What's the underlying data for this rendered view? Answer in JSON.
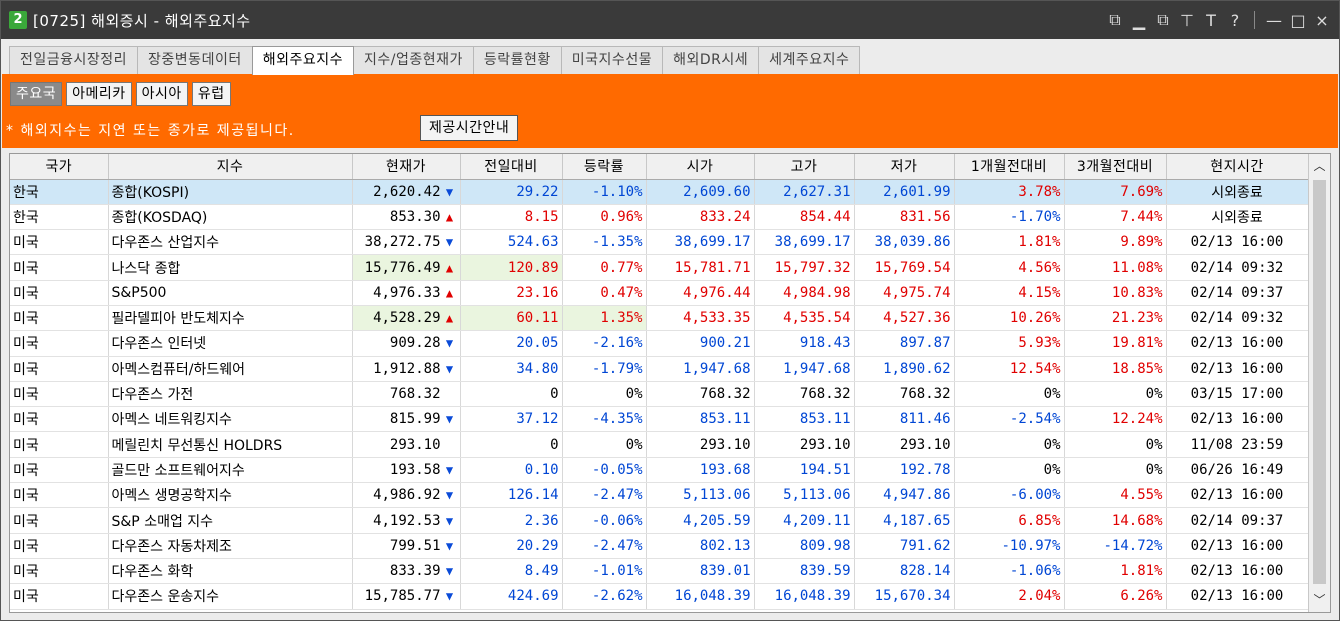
{
  "window": {
    "badge": "2",
    "title": "[0725] 해외증시 - 해외주요지수",
    "controls": [
      "⧉",
      "▁",
      "⧉",
      "⊤",
      "T",
      "?",
      "—",
      "□",
      "×"
    ]
  },
  "tabs": [
    "전일금융시장정리",
    "장중변동데이터",
    "해외주요지수",
    "지수/업종현재가",
    "등락률현황",
    "미국지수선물",
    "해외DR시세",
    "세계주요지수"
  ],
  "active_tab": 2,
  "subtabs": [
    "주요국",
    "아메리카",
    "아시아",
    "유럽"
  ],
  "active_subtab": 0,
  "notice": "* 해외지수는 지연 또는 종가로 제공됩니다.",
  "info_button": "제공시간안내",
  "columns": [
    "국가",
    "지수",
    "현재가",
    "전일대비",
    "등락률",
    "시가",
    "고가",
    "저가",
    "1개월전대비",
    "3개월전대비",
    "현지시간"
  ],
  "colors": {
    "up": "#e00000",
    "down": "#0046d4",
    "accent": "#ff6a00",
    "selected_row": "#cfe7f7"
  },
  "rows": [
    {
      "country": "한국",
      "name": "종합(KOSPI)",
      "price": "2,620.42",
      "dir": "down",
      "chg": "29.22",
      "rate": "-1.10%",
      "open": "2,609.60",
      "high": "2,627.31",
      "low": "2,601.99",
      "m1": "3.78%",
      "m3": "7.69%",
      "time": "시외종료"
    },
    {
      "country": "한국",
      "name": "종합(KOSDAQ)",
      "price": "853.30",
      "dir": "up",
      "chg": "8.15",
      "rate": "0.96%",
      "open": "833.24",
      "high": "854.44",
      "low": "831.56",
      "m1": "-1.70%",
      "m3": "7.44%",
      "time": "시외종료"
    },
    {
      "country": "미국",
      "name": "다우존스 산업지수",
      "price": "38,272.75",
      "dir": "down",
      "chg": "524.63",
      "rate": "-1.35%",
      "open": "38,699.17",
      "high": "38,699.17",
      "low": "38,039.86",
      "m1": "1.81%",
      "m3": "9.89%",
      "time": "02/13 16:00"
    },
    {
      "country": "미국",
      "name": "나스닥 종합",
      "price": "15,776.49",
      "dir": "up",
      "chg": "120.89",
      "rate": "0.77%",
      "open": "15,781.71",
      "high": "15,797.32",
      "low": "15,769.54",
      "m1": "4.56%",
      "m3": "11.08%",
      "time": "02/14 09:32"
    },
    {
      "country": "미국",
      "name": "S&P500",
      "price": "4,976.33",
      "dir": "up",
      "chg": "23.16",
      "rate": "0.47%",
      "open": "4,976.44",
      "high": "4,984.98",
      "low": "4,975.74",
      "m1": "4.15%",
      "m3": "10.83%",
      "time": "02/14 09:37"
    },
    {
      "country": "미국",
      "name": "필라델피아 반도체지수",
      "price": "4,528.29",
      "dir": "up",
      "chg": "60.11",
      "rate": "1.35%",
      "open": "4,533.35",
      "high": "4,535.54",
      "low": "4,527.36",
      "m1": "10.26%",
      "m3": "21.23%",
      "time": "02/14 09:32"
    },
    {
      "country": "미국",
      "name": "다우존스 인터넷",
      "price": "909.28",
      "dir": "down",
      "chg": "20.05",
      "rate": "-2.16%",
      "open": "900.21",
      "high": "918.43",
      "low": "897.87",
      "m1": "5.93%",
      "m3": "19.81%",
      "time": "02/13 16:00"
    },
    {
      "country": "미국",
      "name": "아멕스컴퓨터/하드웨어",
      "price": "1,912.88",
      "dir": "down",
      "chg": "34.80",
      "rate": "-1.79%",
      "open": "1,947.68",
      "high": "1,947.68",
      "low": "1,890.62",
      "m1": "12.54%",
      "m3": "18.85%",
      "time": "02/13 16:00"
    },
    {
      "country": "미국",
      "name": "다우존스 가전",
      "price": "768.32",
      "dir": "none",
      "chg": "0",
      "rate": "0%",
      "open": "768.32",
      "high": "768.32",
      "low": "768.32",
      "m1": "0%",
      "m3": "0%",
      "time": "03/15 17:00"
    },
    {
      "country": "미국",
      "name": "아멕스 네트워킹지수",
      "price": "815.99",
      "dir": "down",
      "chg": "37.12",
      "rate": "-4.35%",
      "open": "853.11",
      "high": "853.11",
      "low": "811.46",
      "m1": "-2.54%",
      "m3": "12.24%",
      "time": "02/13 16:00"
    },
    {
      "country": "미국",
      "name": "메릴린치 무선통신 HOLDRS",
      "price": "293.10",
      "dir": "none",
      "chg": "0",
      "rate": "0%",
      "open": "293.10",
      "high": "293.10",
      "low": "293.10",
      "m1": "0%",
      "m3": "0%",
      "time": "11/08 23:59"
    },
    {
      "country": "미국",
      "name": "골드만 소프트웨어지수",
      "price": "193.58",
      "dir": "down",
      "chg": "0.10",
      "rate": "-0.05%",
      "open": "193.68",
      "high": "194.51",
      "low": "192.78",
      "m1": "0%",
      "m3": "0%",
      "time": "06/26 16:49"
    },
    {
      "country": "미국",
      "name": "아멕스 생명공학지수",
      "price": "4,986.92",
      "dir": "down",
      "chg": "126.14",
      "rate": "-2.47%",
      "open": "5,113.06",
      "high": "5,113.06",
      "low": "4,947.86",
      "m1": "-6.00%",
      "m3": "4.55%",
      "time": "02/13 16:00"
    },
    {
      "country": "미국",
      "name": "S&P 소매업 지수",
      "price": "4,192.53",
      "dir": "down",
      "chg": "2.36",
      "rate": "-0.06%",
      "open": "4,205.59",
      "high": "4,209.11",
      "low": "4,187.65",
      "m1": "6.85%",
      "m3": "14.68%",
      "time": "02/14 09:37"
    },
    {
      "country": "미국",
      "name": "다우존스 자동차제조",
      "price": "799.51",
      "dir": "down",
      "chg": "20.29",
      "rate": "-2.47%",
      "open": "802.13",
      "high": "809.98",
      "low": "791.62",
      "m1": "-10.97%",
      "m3": "-14.72%",
      "time": "02/13 16:00"
    },
    {
      "country": "미국",
      "name": "다우존스 화학",
      "price": "833.39",
      "dir": "down",
      "chg": "8.49",
      "rate": "-1.01%",
      "open": "839.01",
      "high": "839.59",
      "low": "828.14",
      "m1": "-1.06%",
      "m3": "1.81%",
      "time": "02/13 16:00"
    },
    {
      "country": "미국",
      "name": "다우존스 운송지수",
      "price": "15,785.77",
      "dir": "down",
      "chg": "424.69",
      "rate": "-2.62%",
      "open": "16,048.39",
      "high": "16,048.39",
      "low": "15,670.34",
      "m1": "2.04%",
      "m3": "6.26%",
      "time": "02/13 16:00"
    }
  ]
}
